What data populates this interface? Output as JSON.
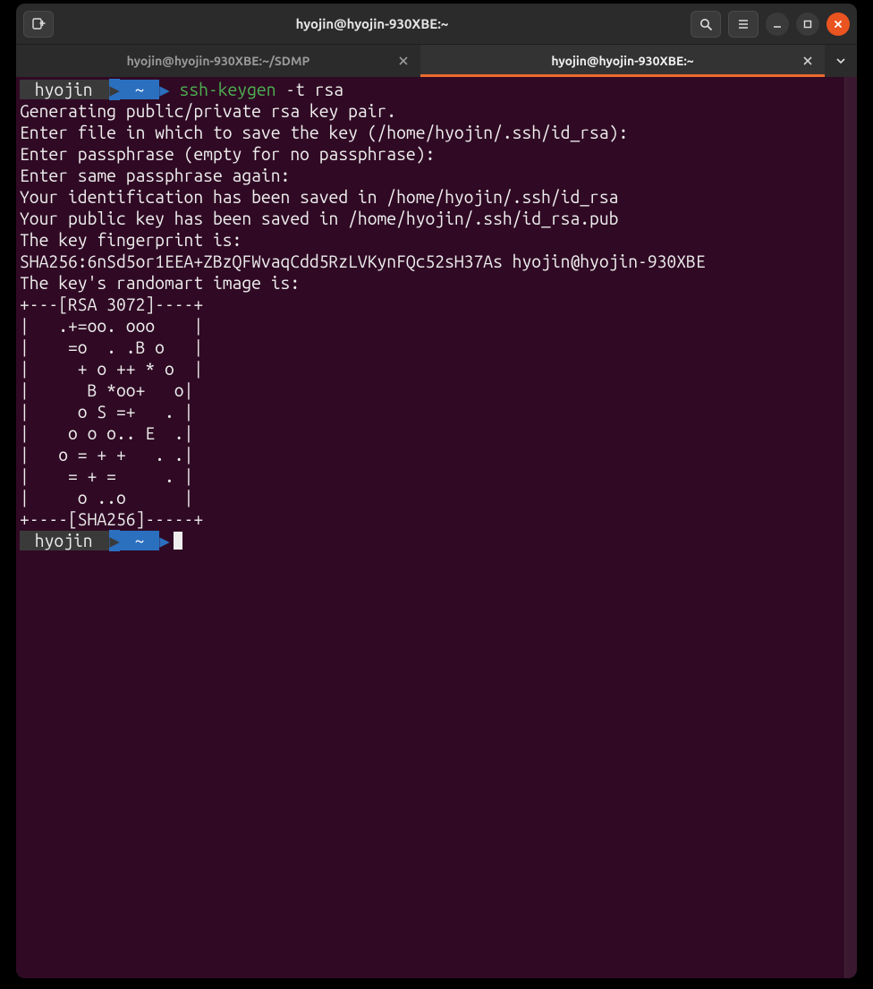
{
  "window": {
    "title": "hyojin@hyojin-930XBE:~"
  },
  "tabs": [
    {
      "label": "hyojin@hyojin-930XBE:~/SDMP",
      "active": false
    },
    {
      "label": "hyojin@hyojin-930XBE:~",
      "active": true
    }
  ],
  "prompt": {
    "user": "hyojin",
    "dir": "~",
    "command_green": "ssh-keygen",
    "command_rest": " -t rsa"
  },
  "output_lines": [
    "Generating public/private rsa key pair.",
    "Enter file in which to save the key (/home/hyojin/.ssh/id_rsa):",
    "Enter passphrase (empty for no passphrase):",
    "Enter same passphrase again:",
    "Your identification has been saved in /home/hyojin/.ssh/id_rsa",
    "Your public key has been saved in /home/hyojin/.ssh/id_rsa.pub",
    "The key fingerprint is:",
    "SHA256:6nSd5or1EEA+ZBzQFWvaqCdd5RzLVKynFQc52sH37As hyojin@hyojin-930XBE",
    "The key's randomart image is:",
    "+---[RSA 3072]----+",
    "|   .+=oo. ooo    |",
    "|    =o  . .B o   |",
    "|     + o ++ * o  |",
    "|      B *oo+   o|",
    "|     o S =+   . |",
    "|    o o o.. E  .|",
    "|   o = + +   . .|",
    "|    = + =     . |",
    "|     o ..o      |",
    "+----[SHA256]-----+"
  ],
  "prompt2": {
    "user": "hyojin",
    "dir": "~"
  }
}
